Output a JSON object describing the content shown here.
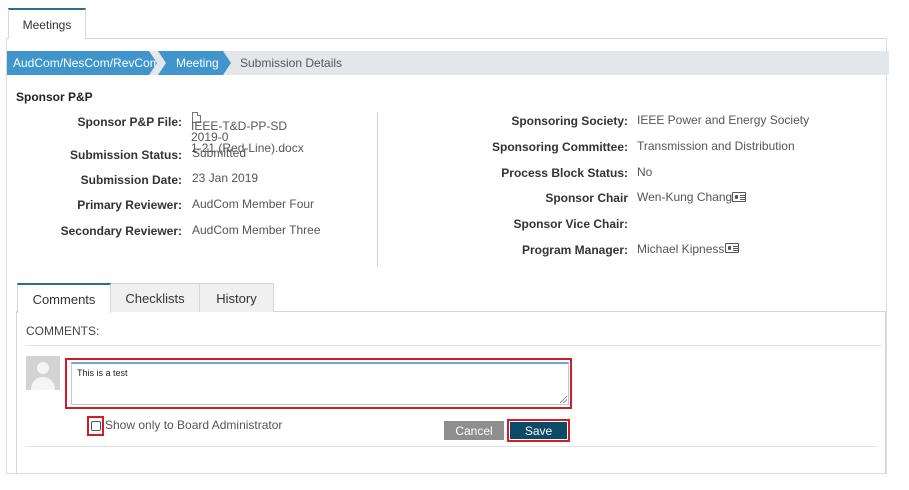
{
  "top_tab": {
    "label": "Meetings"
  },
  "breadcrumb": {
    "items": [
      "AudCom/NesCom/RevCom",
      "Meeting",
      "Submission Details"
    ]
  },
  "section": {
    "title": "Sponsor P&P"
  },
  "left_fields": {
    "file_label": "Sponsor P&P File:",
    "file_name_line1": "IEEE-T&D-PP-SD 2019-0",
    "file_name_line2": "1-21 (Red-Line).docx",
    "submission_status_label": "Submission Status:",
    "submission_status_value": "Submitted",
    "submission_date_label": "Submission Date:",
    "submission_date_value": "23 Jan 2019",
    "primary_reviewer_label": "Primary Reviewer:",
    "primary_reviewer_value": "AudCom Member Four",
    "secondary_reviewer_label": "Secondary Reviewer:",
    "secondary_reviewer_value": "AudCom Member Three"
  },
  "right_fields": {
    "sponsoring_society_label": "Sponsoring Society:",
    "sponsoring_society_value": "IEEE Power and Energy Society",
    "sponsoring_committee_label": "Sponsoring Committee:",
    "sponsoring_committee_value": "Transmission and Distribution",
    "process_block_label": "Process Block Status:",
    "process_block_value": "No",
    "sponsor_chair_label": "Sponsor Chair",
    "sponsor_chair_value": "Wen-Kung Chang",
    "sponsor_vice_chair_label": "Sponsor Vice Chair:",
    "program_manager_label": "Program Manager:",
    "program_manager_value": "Michael Kipness"
  },
  "tabs": [
    {
      "label": "Comments",
      "active": true
    },
    {
      "label": "Checklists",
      "active": false
    },
    {
      "label": "History",
      "active": false
    }
  ],
  "comments": {
    "heading": "COMMENTS:",
    "text": "This is a test",
    "checkbox_label": "Show only to Board Administrator",
    "checkbox_checked": false,
    "cancel_label": "Cancel",
    "save_label": "Save"
  },
  "icons": {
    "file": "word-document-icon",
    "contact": "contact-card-icon",
    "avatar": "user-avatar-icon"
  },
  "colors": {
    "accent": "#3f95cc",
    "save_button": "#0e4a68",
    "cancel_button": "#8e8e8e",
    "highlight": "#cc1f28"
  }
}
